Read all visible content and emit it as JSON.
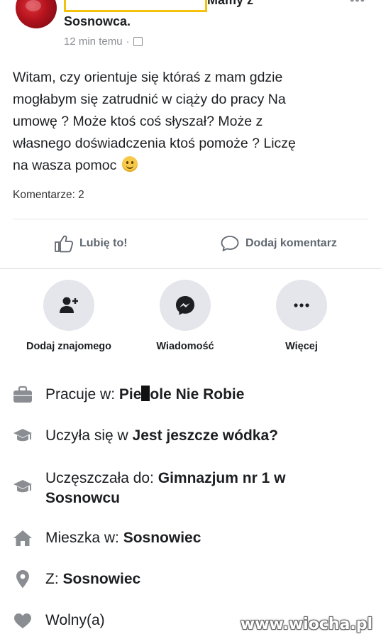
{
  "post": {
    "author_tail": "Mamy z",
    "group_name": "Sosnowca.",
    "time": "12 min temu",
    "text_lines": [
      "Witam, czy orientuje się któraś z mam gdzie",
      "mogłabym się zatrudnić w ciąży do pracy Na",
      "umowę ? Może ktoś coś słyszał? Może z",
      "własnego doświadczenia ktoś pomoże ? Liczę",
      "na wasza pomoc"
    ],
    "comments_count": "Komentarze: 2",
    "like_label": "Lubię to!",
    "comment_label": "Dodaj komentarz"
  },
  "profile_actions": {
    "add_friend": "Dodaj znajomego",
    "message": "Wiadomość",
    "more": "Więcej"
  },
  "info": {
    "work_label": "Pracuje w:",
    "work_value_a": "Pie",
    "work_value_b": "ole Nie Robie",
    "studied_label": "Uczyła się w",
    "studied_value": "Jest jeszcze wódka?",
    "attended_label": "Uczęszczała do:",
    "attended_value": "Gimnazjum nr 1 w Sosnowcu",
    "lives_label": "Mieszka w:",
    "lives_value": "Sosnowiec",
    "from_label": "Z:",
    "from_value": "Sosnowiec",
    "relationship": "Wolny(a)"
  },
  "watermark": "www.wiocha.pl",
  "colors": {
    "icon_gray": "#606770",
    "circle_bg": "#e4e6eb",
    "highlight": "#f4c20d"
  }
}
